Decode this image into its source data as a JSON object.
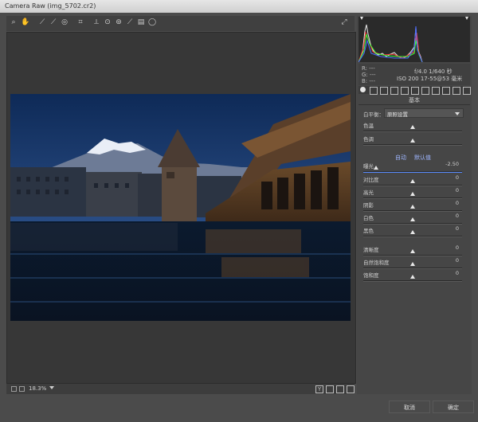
{
  "window": {
    "title": "Camera Raw (img_5702.cr2)"
  },
  "toolbar": {
    "tools": [
      "search-icon",
      "hand-icon",
      "eyedropper-icon",
      "color-sampler-icon",
      "target-adjust-icon",
      "crop-icon",
      "straighten-icon",
      "spot-removal-icon",
      "red-eye-icon",
      "brush-icon",
      "preferences-icon",
      "rotate-icon"
    ]
  },
  "status": {
    "zoom": "18.3%"
  },
  "info": {
    "r": "R: ---",
    "g": "G: ---",
    "b": "B: ---",
    "exposure_line": "f/4.0  1/640 秒",
    "iso_line": "ISO 200  17-55@53 毫米"
  },
  "panel": {
    "title": "基本",
    "white_balance_label": "白平衡：",
    "white_balance_value": "原照设置",
    "temp_label": "色温",
    "tint_label": "色调",
    "auto_label": "自动",
    "default_label": "默认值",
    "exposure": {
      "label": "曝光",
      "value": "-2.50"
    },
    "contrast": {
      "label": "对比度",
      "value": "0"
    },
    "highlights": {
      "label": "高光",
      "value": "0"
    },
    "shadows": {
      "label": "阴影",
      "value": "0"
    },
    "whites": {
      "label": "白色",
      "value": "0"
    },
    "blacks": {
      "label": "黑色",
      "value": "0"
    },
    "clarity": {
      "label": "清晰度",
      "value": "0"
    },
    "vibrance": {
      "label": "自然饱和度",
      "value": "0"
    },
    "saturation": {
      "label": "饱和度",
      "value": "0"
    }
  },
  "buttons": {
    "cancel": "取消",
    "ok": "确定"
  },
  "slider_positions": {
    "temp": 0.5,
    "tint": 0.5,
    "exposure": 0.13,
    "contrast": 0.5,
    "highlights": 0.5,
    "shadows": 0.5,
    "whites": 0.5,
    "blacks": 0.5,
    "clarity": 0.5,
    "vibrance": 0.5,
    "saturation": 0.5
  },
  "colors": {
    "accent": "#5a8cff",
    "panel": "#464646"
  }
}
